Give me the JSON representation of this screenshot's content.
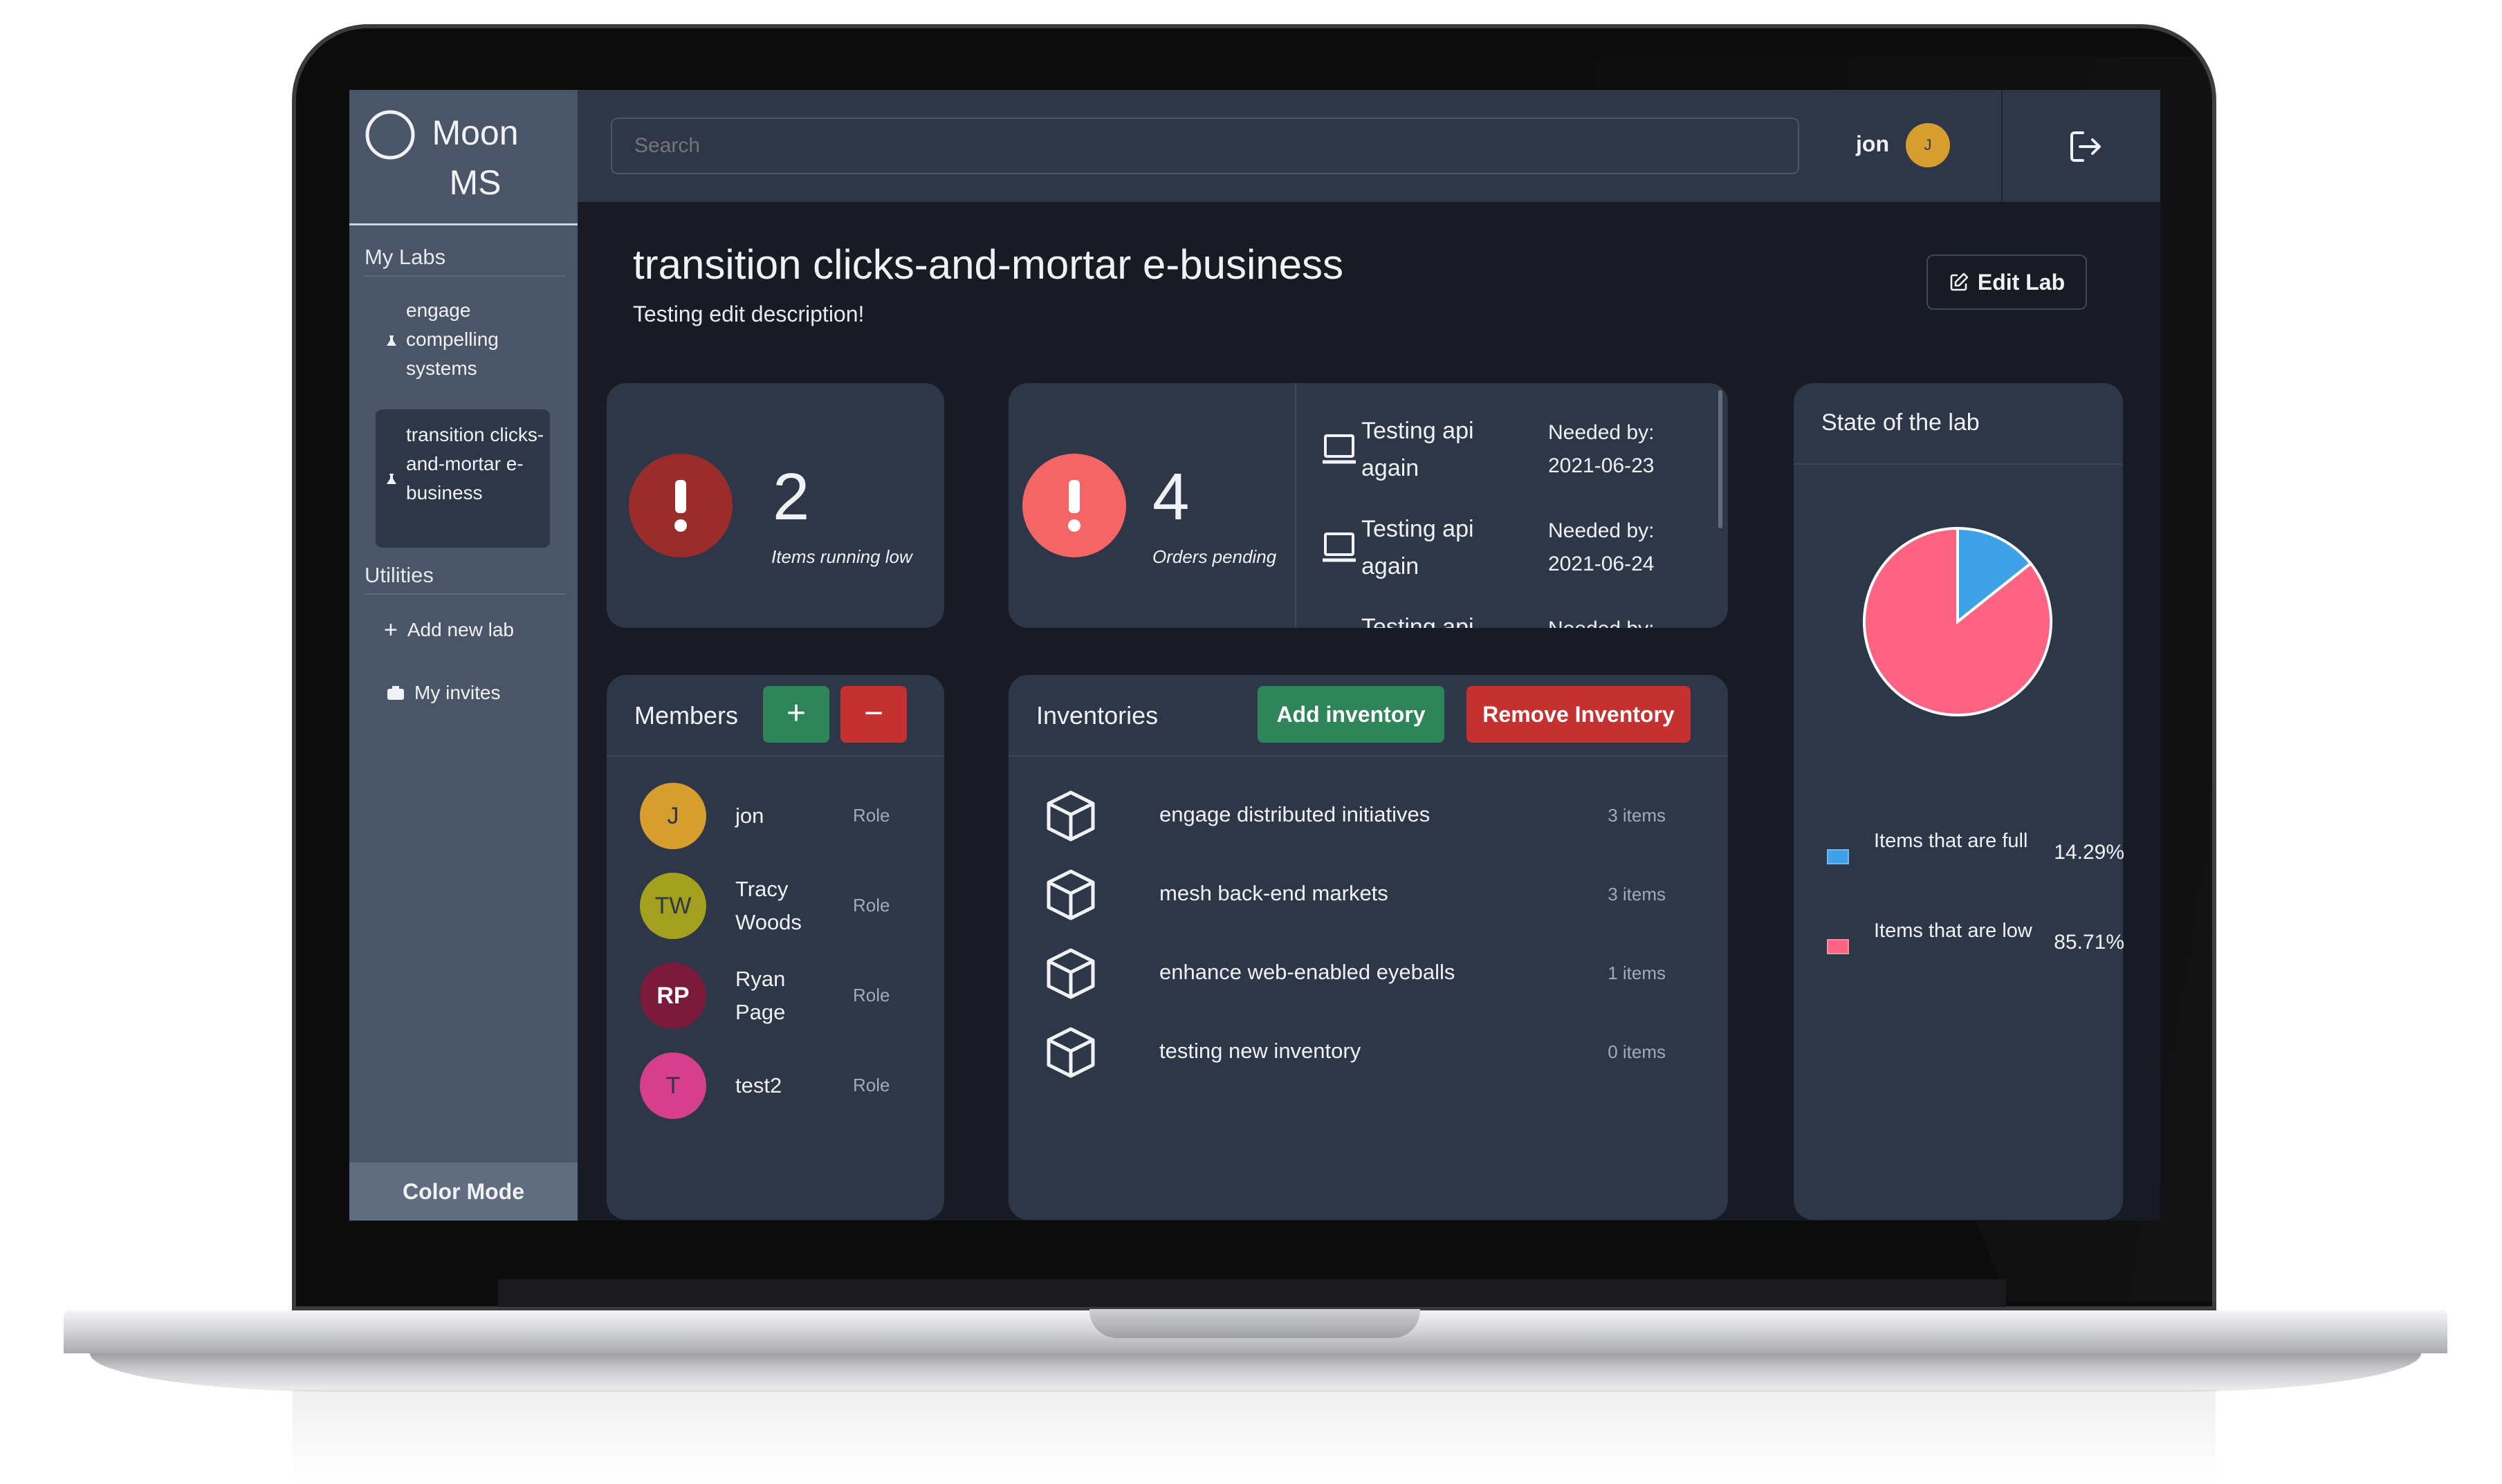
{
  "app": {
    "brand": "Moon MS"
  },
  "sidebar": {
    "my_labs_heading": "My Labs",
    "labs": [
      {
        "label": "engage compelling systems",
        "active": false
      },
      {
        "label": "transition clicks-and-mortar e-business",
        "active": true
      }
    ],
    "utilities_heading": "Utilities",
    "utilities": [
      {
        "label": "Add new lab",
        "icon": "plus-icon"
      },
      {
        "label": "My invites",
        "icon": "inbox-icon"
      }
    ],
    "color_mode_label": "Color Mode"
  },
  "topbar": {
    "search_placeholder": "Search",
    "user_name": "jon",
    "user_initial": "J",
    "logout_icon": "logout-icon"
  },
  "page": {
    "title": "transition clicks-and-mortar e-business",
    "description": "Testing edit description!",
    "edit_button_label": "Edit Lab"
  },
  "stats": {
    "low_items": {
      "count": "2",
      "caption": "Items running low",
      "color": "#9b2c2c"
    },
    "orders": {
      "count": "4",
      "caption": "Orders pending",
      "color": "#f56565"
    }
  },
  "orders": [
    {
      "name": "Testing api again",
      "needed": "Needed by: 2021-06-23"
    },
    {
      "name": "Testing api again",
      "needed": "Needed by: 2021-06-24"
    },
    {
      "name": "Testing api",
      "needed": "Needed by:"
    }
  ],
  "members": {
    "title": "Members",
    "add_label": "+",
    "remove_label": "−",
    "list": [
      {
        "initials": "J",
        "name": "jon",
        "role": "Role",
        "color": "#d69e2e"
      },
      {
        "initials": "TW",
        "name": "Tracy Woods",
        "role": "Role",
        "color": "#a3a020"
      },
      {
        "initials": "RP",
        "name": "Ryan Page",
        "role": "Role",
        "color": "#7b1a3a"
      },
      {
        "initials": "T",
        "name": "test2",
        "role": "Role",
        "color": "#d53f8c"
      }
    ]
  },
  "inventories": {
    "title": "Inventories",
    "add_label": "Add inventory",
    "remove_label": "Remove Inventory",
    "list": [
      {
        "name": "engage distributed initiatives",
        "count": "3 items"
      },
      {
        "name": "mesh back-end markets",
        "count": "3 items"
      },
      {
        "name": "enhance web-enabled eyeballs",
        "count": "1 items"
      },
      {
        "name": "testing new inventory",
        "count": "0 items"
      }
    ]
  },
  "state": {
    "title": "State of the lab"
  },
  "chart_data": {
    "type": "pie",
    "title": "State of the lab",
    "series": [
      {
        "name": "Items that are full",
        "value": 14.29,
        "label": "14.29%",
        "color": "#3fa2e8"
      },
      {
        "name": "Items that are low",
        "value": 85.71,
        "label": "85.71%",
        "color": "#ff6384"
      }
    ]
  }
}
